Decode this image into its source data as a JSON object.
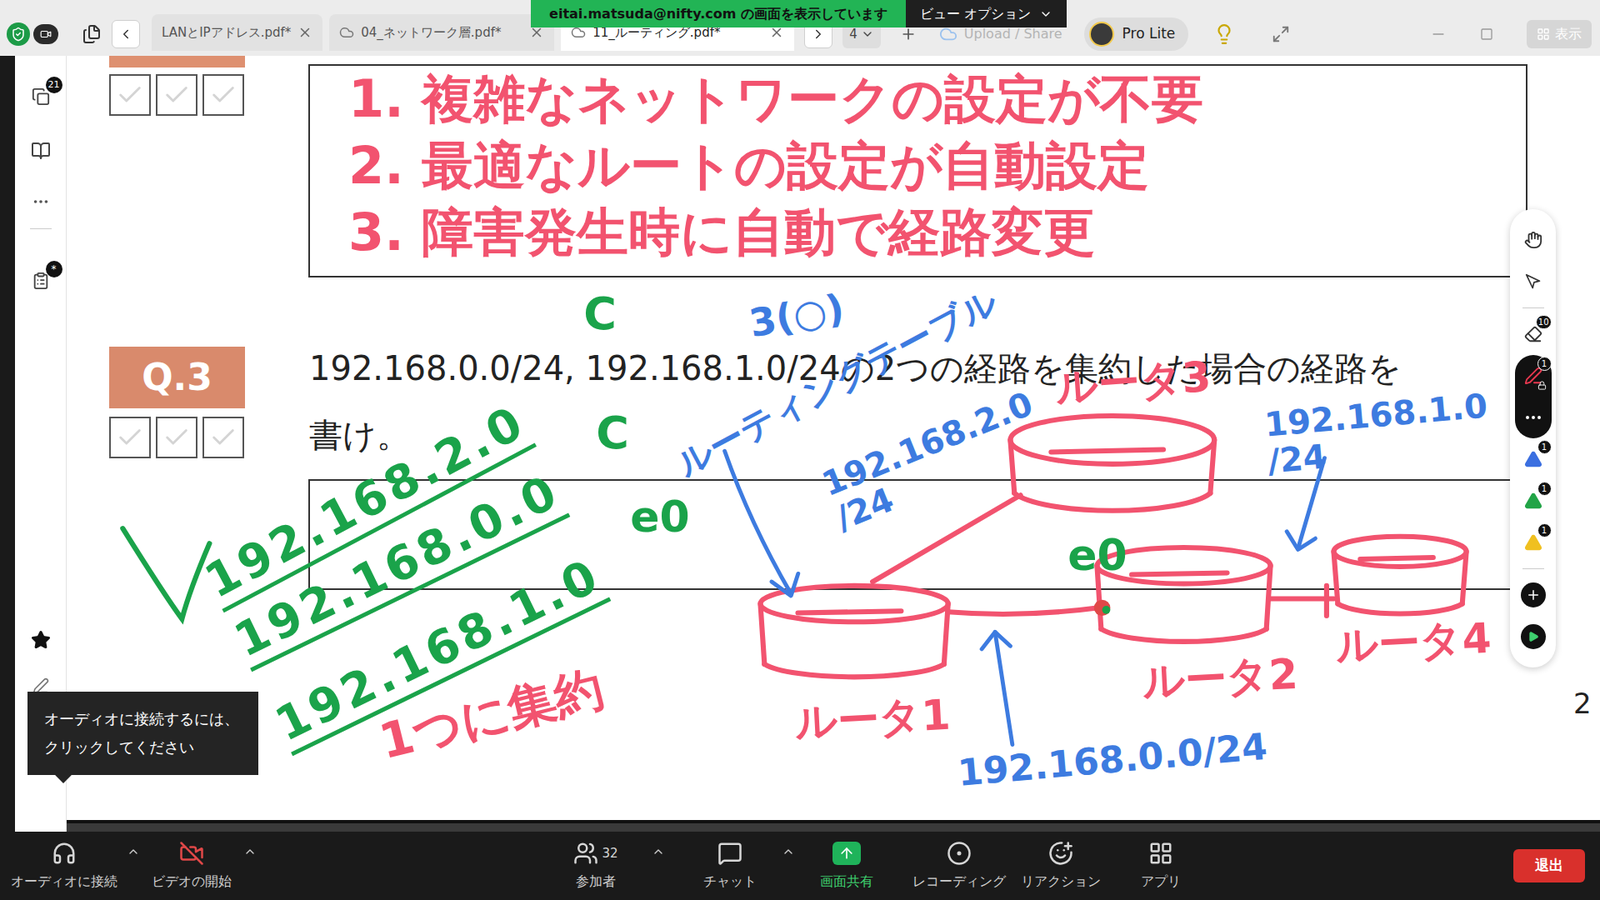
{
  "viewer": {
    "banner": "eitai.matsuda@nifty.com の画面を表示しています",
    "view_options": "ビュー オプション",
    "plan": "Pro Lite",
    "show_button": "表示",
    "page_select": "4",
    "upload_share": "Upload / Share"
  },
  "tabs": [
    {
      "label": "LANとIPアドレス.pdf*",
      "selected": false,
      "cloud": false
    },
    {
      "label": "04_ネットワーク層.pdf*",
      "selected": false,
      "cloud": true
    },
    {
      "label": "11_ルーティング.pdf*",
      "selected": true,
      "cloud": true
    }
  ],
  "sidebar": {
    "pages_badge": "21",
    "comments_badge": "*"
  },
  "document": {
    "previous_answer": [
      "1. 複雑なネットワークの設定が不要",
      "2. 最適なルートの設定が自動設定",
      "3. 障害発生時に自動で経路変更"
    ],
    "question": {
      "label": "Q.3",
      "text": [
        "192.168.0.0/24, 192.168.1.0/24の2つの経路を集約した場合の経路を",
        "書け。"
      ]
    },
    "page_number": "2",
    "annotations": [
      {
        "lines": [
          "192.168.2.0"
        ],
        "color": "#1aa34a",
        "underlined": true
      },
      {
        "lines": [
          "192.168.0.0"
        ],
        "color": "#1aa34a",
        "underlined": true
      },
      {
        "lines": [
          "192.168.1.0"
        ],
        "color": "#1aa34a",
        "underlined": true
      },
      {
        "lines": [
          "1つに集約"
        ],
        "color": "#f2536f",
        "underlined": false
      },
      {
        "lines": [
          "C"
        ],
        "color": "#1aa34a",
        "underlined": false
      },
      {
        "lines": [
          "C"
        ],
        "color": "#1aa34a",
        "underlined": false
      },
      {
        "lines": [
          "e0"
        ],
        "color": "#1aa34a",
        "underlined": false
      },
      {
        "lines": [
          "3(○)"
        ],
        "color": "#3d7be0",
        "underlined": false
      },
      {
        "lines": [
          "ルーティングテーブル"
        ],
        "color": "#3d7be0",
        "underlined": false
      },
      {
        "lines": [
          "192.168.2.0",
          "/24"
        ],
        "color": "#3d7be0",
        "underlined": false
      },
      {
        "lines": [
          "ルータ3"
        ],
        "color": "#f2536f",
        "underlined": false
      },
      {
        "lines": [
          "192.168.1.0",
          "/24"
        ],
        "color": "#3d7be0",
        "underlined": false
      },
      {
        "lines": [
          "e0"
        ],
        "color": "#1aa34a",
        "underlined": false
      },
      {
        "lines": [
          "ルータ1"
        ],
        "color": "#f2536f",
        "underlined": false
      },
      {
        "lines": [
          "ルータ2"
        ],
        "color": "#f2536f",
        "underlined": false
      },
      {
        "lines": [
          "ルータ4"
        ],
        "color": "#f2536f",
        "underlined": false
      },
      {
        "lines": [
          "192.168.0.0/24"
        ],
        "color": "#3d7be0",
        "underlined": false
      }
    ]
  },
  "tools": [
    {
      "kind": "hand",
      "badge": "",
      "selected": false,
      "locked": false,
      "color": "#333333"
    },
    {
      "kind": "select",
      "badge": "",
      "selected": false,
      "locked": false,
      "color": "#333333"
    },
    {
      "kind": "eraser",
      "badge": "10",
      "selected": false,
      "locked": false,
      "color": "#333333"
    },
    {
      "kind": "pen",
      "badge": "1",
      "selected": true,
      "locked": true,
      "color": "#e8384f"
    },
    {
      "kind": "more",
      "badge": "",
      "selected": true,
      "locked": false,
      "color": "#ffffff"
    },
    {
      "kind": "shape",
      "badge": "1",
      "selected": false,
      "locked": false,
      "color": "#3b6fe0"
    },
    {
      "kind": "shape",
      "badge": "1",
      "selected": false,
      "locked": false,
      "color": "#22a447"
    },
    {
      "kind": "shape",
      "badge": "1",
      "selected": false,
      "locked": false,
      "color": "#f0c020"
    },
    {
      "kind": "add",
      "badge": "",
      "selected": false,
      "locked": false,
      "color": "#111111"
    },
    {
      "kind": "toggle",
      "badge": "",
      "selected": false,
      "locked": false,
      "color": "#111111"
    }
  ],
  "tooltip": "オーディオに接続するには、クリックしてください",
  "controls": [
    {
      "kind": "audio",
      "label": "オーディオに接続",
      "menu": true,
      "off": false,
      "highlighted": false,
      "count": ""
    },
    {
      "kind": "video",
      "label": "ビデオの開始",
      "menu": true,
      "off": true,
      "highlighted": false,
      "count": ""
    },
    {
      "kind": "participants",
      "label": "参加者",
      "menu": true,
      "off": false,
      "highlighted": false,
      "count": "32"
    },
    {
      "kind": "chat",
      "label": "チャット",
      "menu": true,
      "off": false,
      "highlighted": false,
      "count": ""
    },
    {
      "kind": "share",
      "label": "画面共有",
      "menu": false,
      "off": false,
      "highlighted": true,
      "count": ""
    },
    {
      "kind": "record",
      "label": "レコーディング",
      "menu": false,
      "off": false,
      "highlighted": false,
      "count": ""
    },
    {
      "kind": "reactions",
      "label": "リアクション",
      "menu": false,
      "off": false,
      "highlighted": false,
      "count": ""
    },
    {
      "kind": "apps",
      "label": "アプリ",
      "menu": false,
      "off": false,
      "highlighted": false,
      "count": ""
    }
  ],
  "leave_button": "退出"
}
